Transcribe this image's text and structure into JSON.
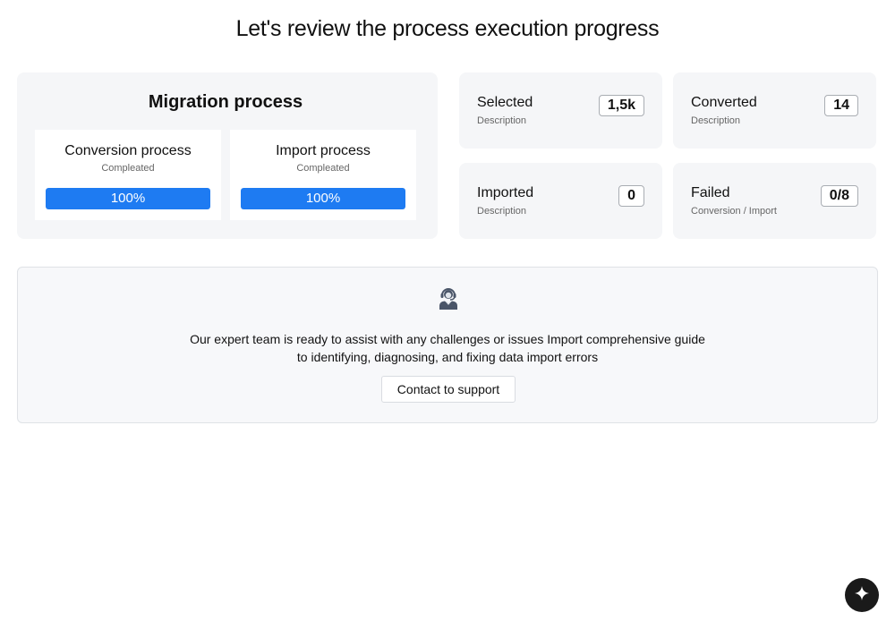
{
  "page": {
    "title": "Let's review the process execution progress"
  },
  "migration": {
    "title": "Migration process",
    "processes": [
      {
        "name": "Conversion process",
        "status": "Compleated",
        "progress_label": "100%",
        "progress": 1.0
      },
      {
        "name": "Import process",
        "status": "Compleated",
        "progress_label": "100%",
        "progress": 1.0
      }
    ]
  },
  "stats": [
    {
      "label": "Selected",
      "description": "Description",
      "value": "1,5k"
    },
    {
      "label": "Converted",
      "description": "Description",
      "value": "14"
    },
    {
      "label": "Imported",
      "description": "Description",
      "value": "0"
    },
    {
      "label": "Failed",
      "description": "Conversion / Import",
      "value": "0/8"
    }
  ],
  "support": {
    "icon": "support-agent-icon",
    "text_line1": "Our expert team is ready to assist with any challenges or issues Import comprehensive guide",
    "text_line2": "to identifying, diagnosing, and fixing data import errors",
    "button_label": "Contact to support"
  },
  "fab": {
    "icon": "sparkle-icon"
  },
  "colors": {
    "accent": "#1e7bf2",
    "panel_bg": "#f5f6f8",
    "fab_bg": "#1a1a1a"
  }
}
